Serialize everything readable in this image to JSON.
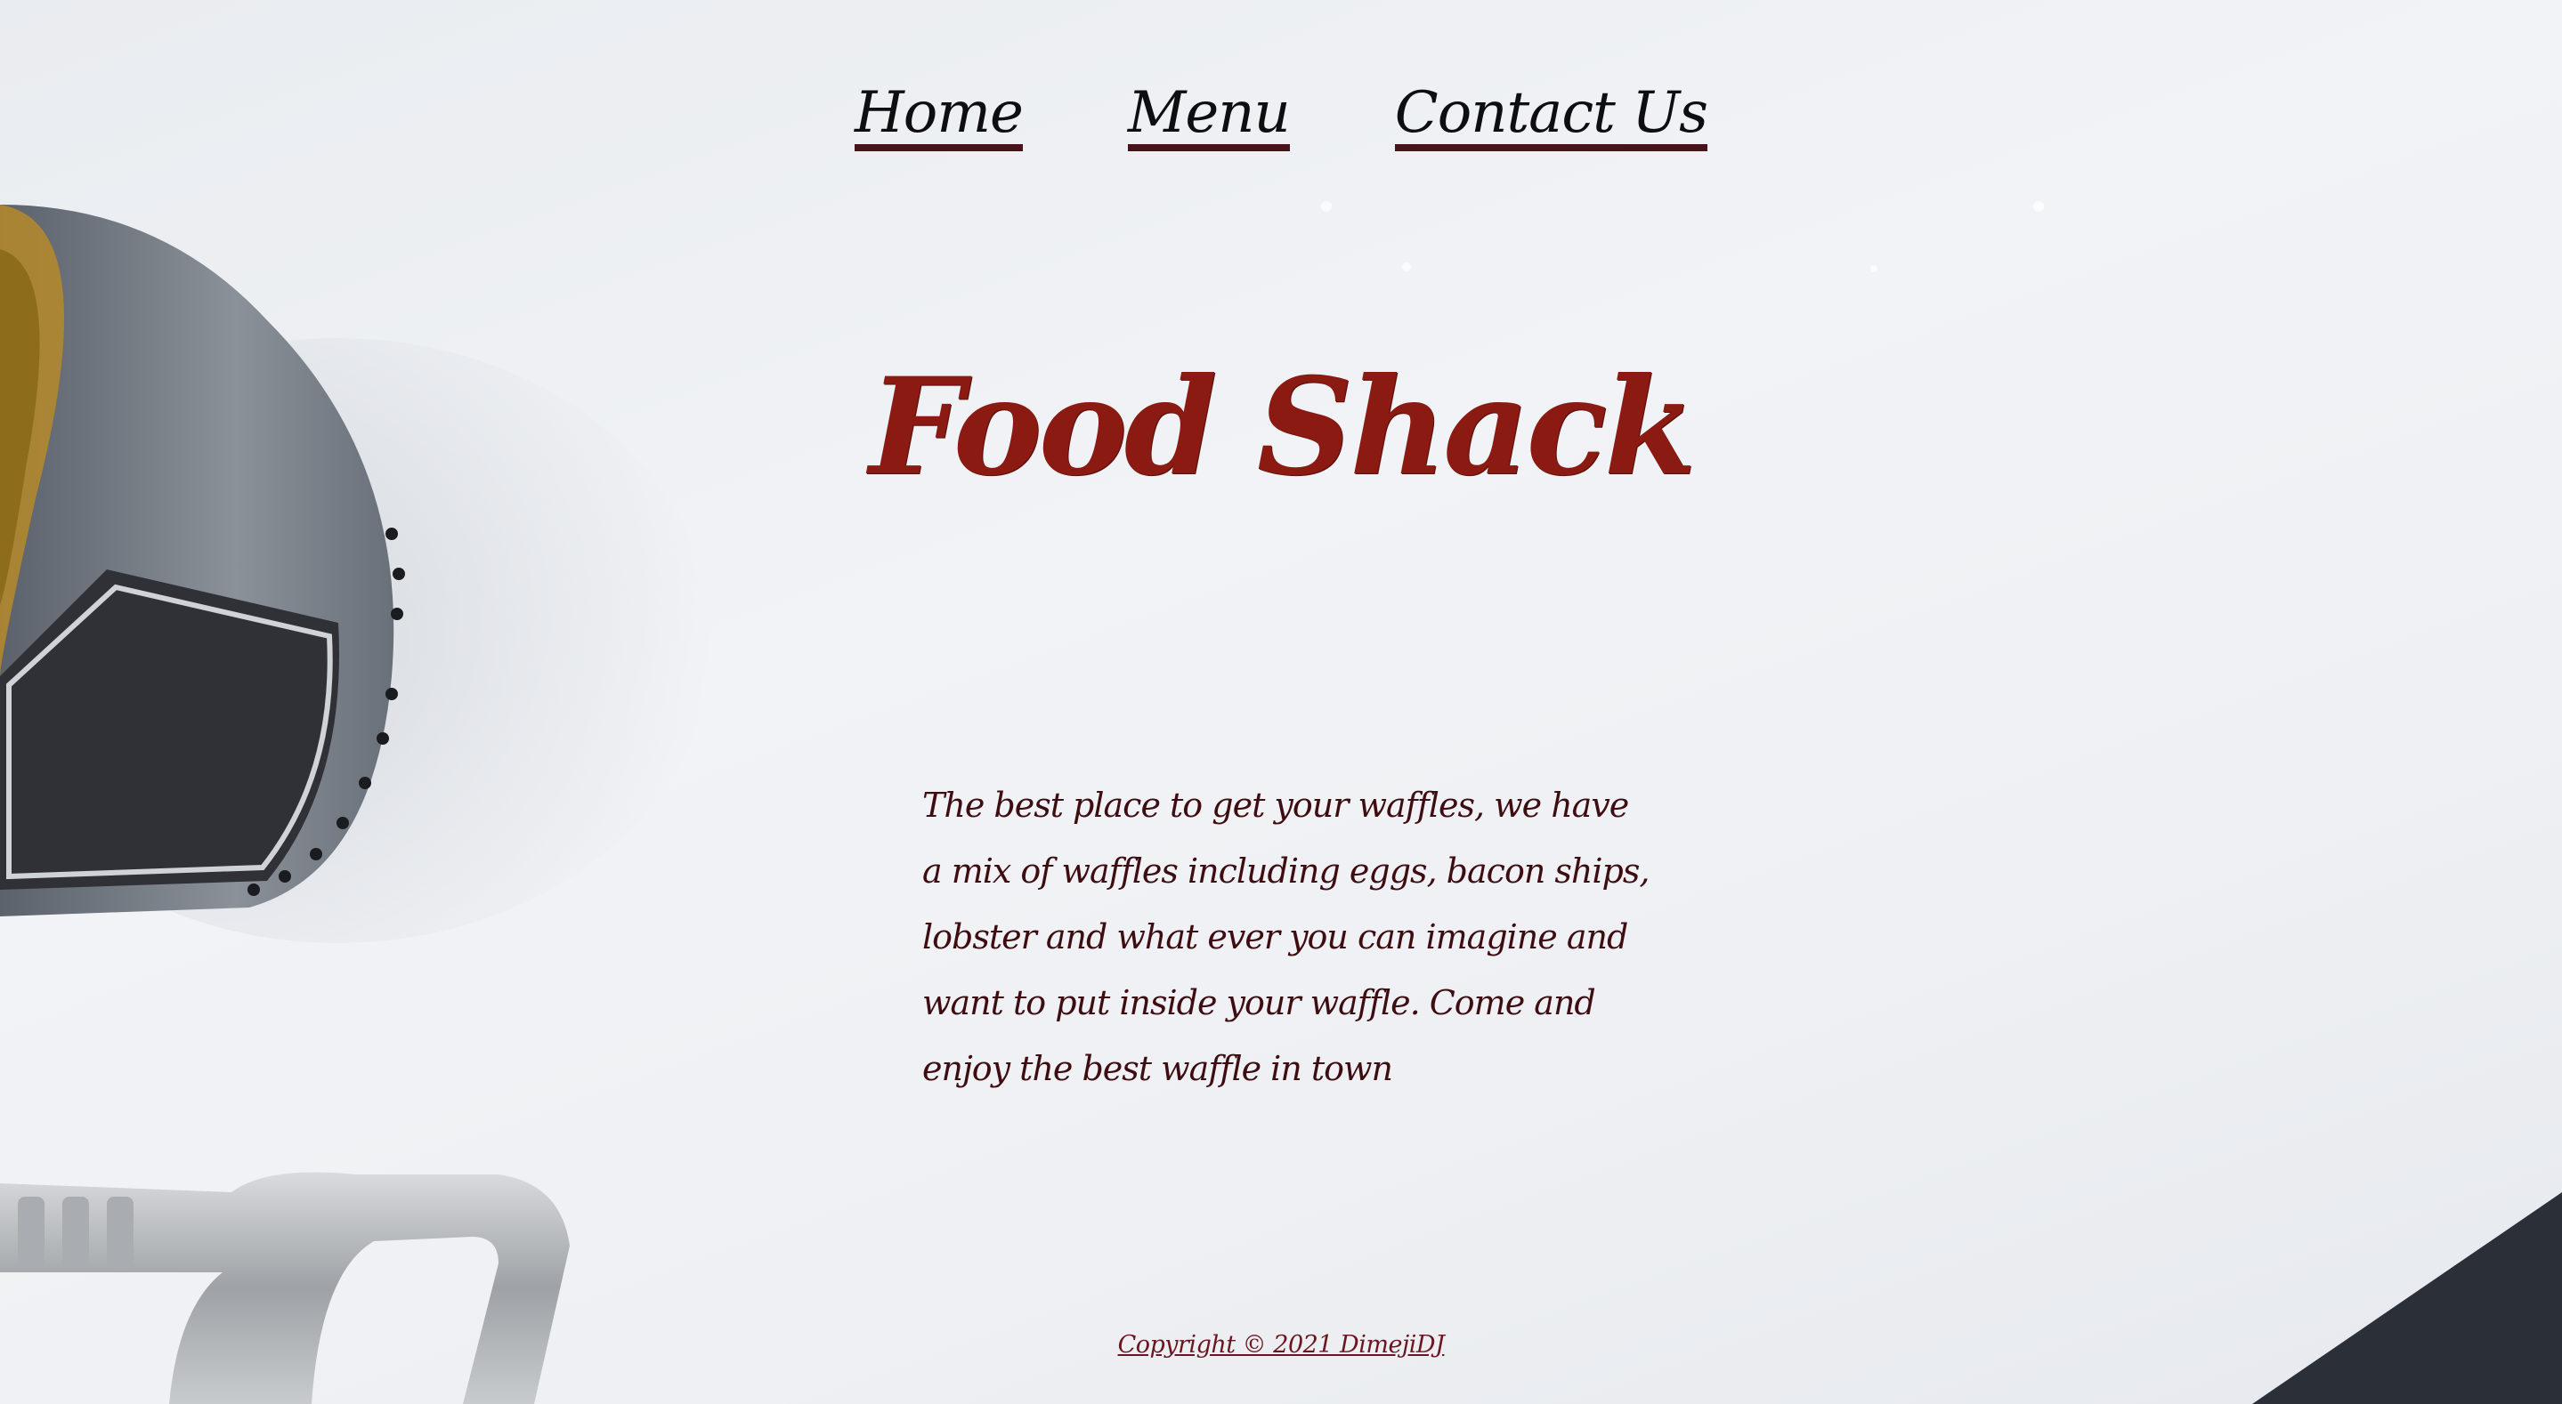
{
  "nav": {
    "items": [
      {
        "label": "Home"
      },
      {
        "label": "Menu"
      },
      {
        "label": "Contact Us"
      }
    ]
  },
  "hero": {
    "title": "Food Shack",
    "description": "The best place to get your waffles, we have a mix of waffles including eggs, bacon ships, lobster and what ever you can imagine and want to put inside your waffle. Come and enjoy the best waffle in town"
  },
  "footer": {
    "copyright": "Copyright ©  2021 DimejiDJ"
  },
  "colors": {
    "title": "#8b1a12",
    "body_text": "#3d0d12",
    "nav_underline": "#4a1219"
  }
}
